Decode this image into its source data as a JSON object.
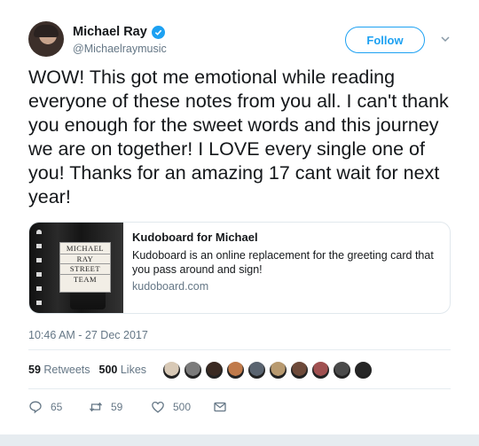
{
  "user": {
    "display_name": "Michael Ray",
    "handle": "@Michaelraymusic",
    "verified": true
  },
  "follow_label": "Follow",
  "tweet_text": "WOW! This got me emotional while reading everyone of these notes from you all. I can't thank you enough for the sweet words and this journey we are on together! I LOVE every single one of you! Thanks for an amazing 17 cant wait for next year!",
  "card": {
    "image_text": [
      "MICHAEL",
      "RAY",
      "STREET",
      "TEAM"
    ],
    "title": "Kudoboard for Michael",
    "description": "Kudoboard is an online replacement for the greeting card that you pass around and sign!",
    "domain": "kudoboard.com"
  },
  "timestamp": "10:46 AM - 27 Dec 2017",
  "stats": {
    "retweets_count": "59",
    "retweets_label": "Retweets",
    "likes_count": "500",
    "likes_label": "Likes"
  },
  "liker_avatars": [
    "#d8c9b6",
    "#7b7b7b",
    "#3a2a22",
    "#c07a4a",
    "#5a6470",
    "#b89a70",
    "#6e4a3a",
    "#a05050",
    "#4a4a4a",
    "#262626"
  ],
  "actions": {
    "reply_count": "65",
    "retweet_count": "59",
    "like_count": "500"
  },
  "icons": [
    "verified-icon",
    "caret-down-icon",
    "reply-icon",
    "retweet-icon",
    "like-icon",
    "message-icon"
  ],
  "colors": {
    "accent": "#1da1f2",
    "secondary_text": "#657786",
    "text": "#14171a"
  }
}
